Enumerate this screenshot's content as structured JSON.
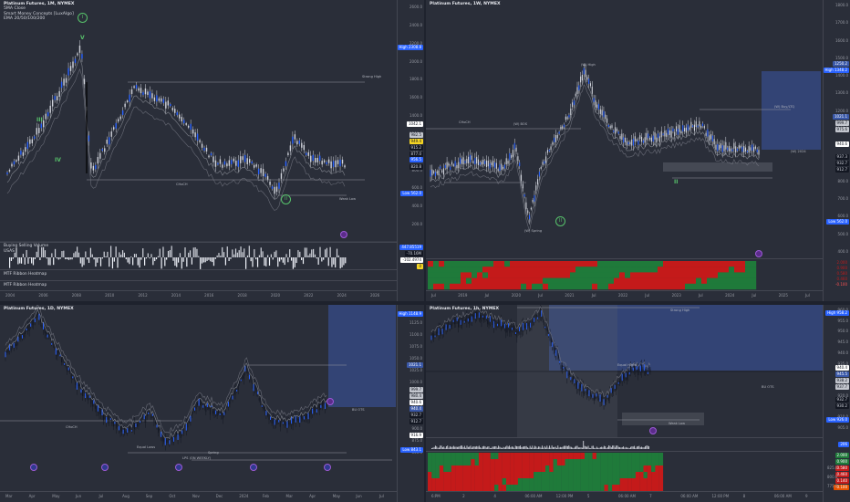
{
  "colors": {
    "bg": "#2a2e39",
    "grid": "#434651",
    "candle": "#d1d4dc",
    "blue": "#2962ff",
    "green": "#1f7a3a",
    "red": "#c41a1a",
    "wave": "#57c26b",
    "zone": "#3a58a8"
  },
  "tl": {
    "title": "Platinum Futures, 1M, NYMEX",
    "ind": [
      "5MA Close",
      "Smart Money Concepts [LuxAlgo]",
      "EMA 20/50/100/200"
    ],
    "ticks": [
      "2600.0",
      "2400.0",
      "2200.0",
      "2000.0",
      "1800.0",
      "1600.0",
      "1400.0",
      "1200.0",
      "1000.0",
      "800.0",
      "600.0",
      "400.0",
      "200.0"
    ],
    "high_label": "High",
    "high_val": "2308.8",
    "low_label": "Low",
    "low_val": "562.0",
    "badges": [
      "1042.1",
      "982.5",
      "949.4",
      "915.2",
      "877.0",
      "956.5",
      "820.8"
    ],
    "vol_badges": [
      "447.85519",
      "-70.16M",
      "21.28665",
      "-102.4974",
      "0"
    ],
    "xaxis": [
      "2004",
      "2006",
      "2008",
      "2010",
      "2012",
      "2014",
      "2016",
      "2018",
      "2020",
      "2022",
      "2024",
      "2026"
    ],
    "sub1": "Buying Selling Volume",
    "sub1b": "USAS",
    "sub2": "MTF Ribbon Heatmap",
    "sub3": "MTF Ribbon Heatmap",
    "waves": [
      "I",
      "II",
      "III",
      "IV",
      "V"
    ],
    "lbls": [
      "CHoCH",
      "Strong High",
      "Weak Low"
    ]
  },
  "tr": {
    "title": "Platinum Futures, 1W, NYMEX",
    "ticks": [
      "1800.0",
      "1700.0",
      "1600.0",
      "1500.0",
      "1400.0",
      "1300.0",
      "1200.0",
      "1100.0",
      "1000.0",
      "900.0",
      "800.0",
      "700.0",
      "600.0",
      "500.0",
      "400.0"
    ],
    "high_label": "High",
    "high_val": "1348.2",
    "low_label": "Low",
    "low_val": "562.0",
    "badges": [
      "1250.2",
      "1021.1",
      "999.7",
      "975.6",
      "940.6",
      "937.3",
      "932.7",
      "912.7"
    ],
    "heat": [
      "2.000",
      "0.900",
      "0.580",
      "0.460",
      "-0.100"
    ],
    "xaxis": [
      "Jul",
      "2019",
      "Jul",
      "2020",
      "Jul",
      "2021",
      "Jul",
      "2022",
      "Jul",
      "2023",
      "Jul",
      "2024",
      "Jul",
      "2025",
      "Jul"
    ],
    "lbls": [
      "CHoCH",
      "(W) BOS",
      "(W) High",
      "(W) 2024",
      "(W) Spring",
      "(W) Buy/LTQ"
    ]
  },
  "bl": {
    "title": "Platinum Futures, 1D, NYMEX",
    "ticks": [
      "1125.0",
      "1100.0",
      "1075.0",
      "1050.0",
      "1025.0",
      "1000.0",
      "975.0",
      "950.0",
      "925.0",
      "900.0",
      "875.0",
      "850.0"
    ],
    "high_label": "High",
    "high_val": "1148.9",
    "low_label": "Low",
    "low_val": "843.1",
    "badges": [
      "1021.1",
      "999.7",
      "980.4",
      "971.0",
      "940.6",
      "937.3",
      "932.7",
      "912.7",
      "940.4",
      "916.9"
    ],
    "xaxis": [
      "Mar",
      "Apr",
      "May",
      "Jun",
      "Jul",
      "Aug",
      "Sep",
      "Oct",
      "Nov",
      "Dec",
      "2024",
      "Feb",
      "Mar",
      "Apr",
      "May",
      "Jun",
      "Jul"
    ],
    "lbls": [
      "CHoCH",
      "Equal Lows",
      "LPS (ON WEEKLY)",
      "Spring",
      "BU OTS"
    ]
  },
  "br": {
    "title": "Platinum Futures, 1h, NYMEX",
    "ticks": [
      "960.0",
      "955.0",
      "950.0",
      "945.0",
      "940.0",
      "935.0",
      "930.0",
      "925.0",
      "920.0",
      "915.0",
      "910.0",
      "905.0"
    ],
    "high_label": "High",
    "high_val": "958.2",
    "low_label": "Low",
    "low_val": "926.0",
    "badges": [
      "940.4",
      "945.5",
      "938.2",
      "937.7",
      "932.7",
      "930.2",
      "926.0"
    ],
    "sub_vals": [
      "206",
      "825.0",
      "800.0",
      "775.0"
    ],
    "heat": [
      "2.000",
      "0.900",
      "0.580",
      "0.460",
      "0.140",
      "-0.100"
    ],
    "xaxis": [
      "6:PM",
      "2",
      "4",
      "06:00 AM",
      "12:00 PM",
      "5",
      "06:00 AM",
      "7",
      "06:00 AM",
      "12:00 PM",
      "8",
      "06:00 AM",
      "9"
    ],
    "lbls": [
      "Strong High",
      "Weak Low",
      "BU OTS",
      "Equal Highs"
    ]
  }
}
